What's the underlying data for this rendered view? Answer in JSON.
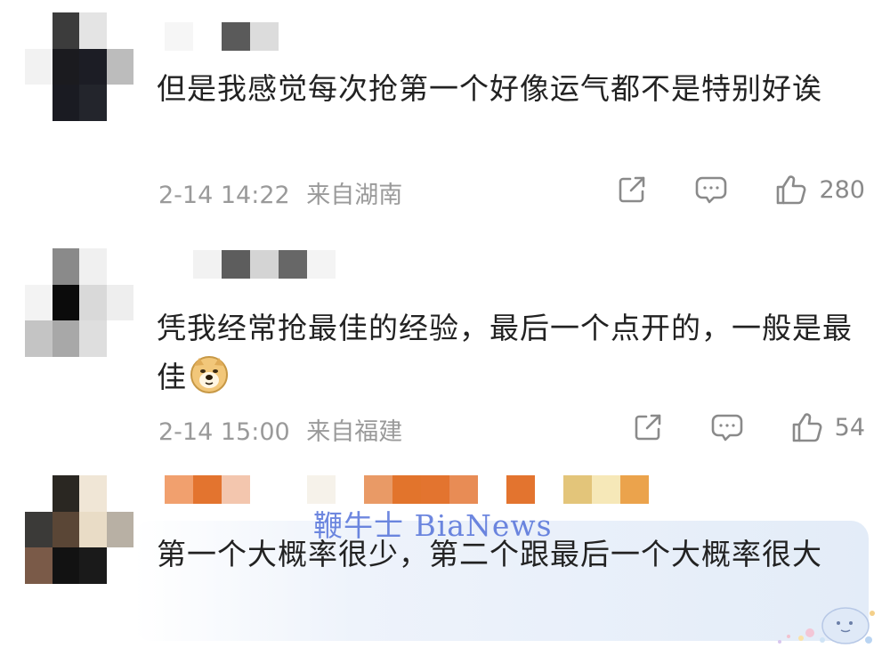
{
  "comments": [
    {
      "text": "但是我感觉每次抢第一个好像运气都不是特别好诶",
      "time": "2-14 14:22",
      "location": "来自湖南",
      "likes": "280",
      "icons": {
        "share": "share-icon",
        "reply": "comment-icon",
        "like": "thumbs-up-icon"
      }
    },
    {
      "text": "凭我经常抢最佳的经验，最后一个点开的，一般是最佳",
      "emoji": "doge-emoji-icon",
      "time": "2-14 15:00",
      "location": "来自福建",
      "likes": "54",
      "icons": {
        "share": "share-icon",
        "reply": "comment-icon",
        "like": "thumbs-up-icon"
      }
    },
    {
      "text": "第一个大概率很少，第二个跟最后一个大概率很大"
    }
  ],
  "watermark": "鞭牛士 BiaNews",
  "colors": {
    "text": "#222222",
    "meta": "#9a9a9a",
    "icon": "#8a8a8a",
    "highlight": "#e3ecf8",
    "watermark": "#4a6ad8"
  }
}
